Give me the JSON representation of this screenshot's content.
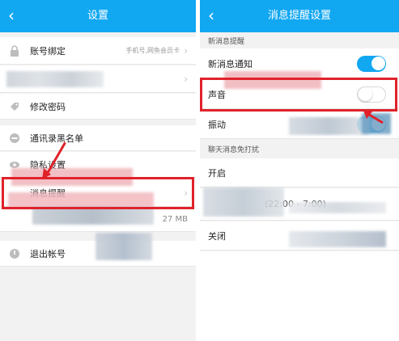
{
  "left": {
    "title": "设置",
    "rows": [
      {
        "label": "账号绑定",
        "value": "手机号,网鱼会员卡"
      },
      {
        "label": "修改密码"
      },
      {
        "label": "通讯录黑名单"
      },
      {
        "label": "隐私设置"
      },
      {
        "label": "消息提醒"
      },
      {
        "label": "退出帐号"
      }
    ],
    "cache_size": "27 MB"
  },
  "right": {
    "title": "消息提醒设置",
    "section_new": "新消息提醒",
    "new_message_label": "新消息通知",
    "sound_label": "声音",
    "vibrate_label": "振动",
    "section_dnd": "聊天消息免打扰",
    "dnd_options": [
      {
        "label": "开启"
      },
      {
        "label": "",
        "sub": "(22:00 - 7:00)"
      },
      {
        "label": "关闭"
      }
    ]
  },
  "toggles": {
    "new_message": true,
    "sound": false,
    "vibrate": true
  },
  "colors": {
    "accent": "#11a7f1",
    "highlight": "#e0222b"
  },
  "icons": {
    "back": "back-arrow-icon",
    "chevron": "chevron-right-icon",
    "lock": "lock-icon",
    "tag": "tag-icon",
    "block": "block-icon",
    "eye": "eye-icon",
    "logout": "logout-icon"
  }
}
